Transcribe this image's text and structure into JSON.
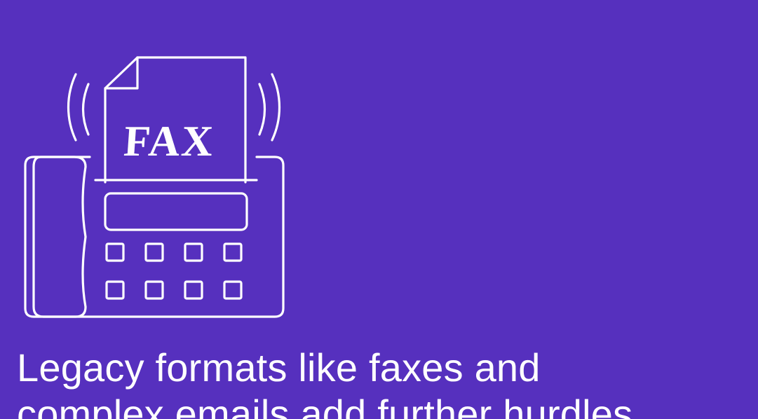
{
  "illustration": {
    "icon": "fax-machine-icon",
    "paper_text": "FAX",
    "stroke_color": "#FFFFFF"
  },
  "headline": {
    "line1": "Legacy formats like faxes and",
    "line2": "complex emails add further hurdles"
  },
  "colors": {
    "background": "#5630BE",
    "foreground": "#FFFFFF"
  }
}
